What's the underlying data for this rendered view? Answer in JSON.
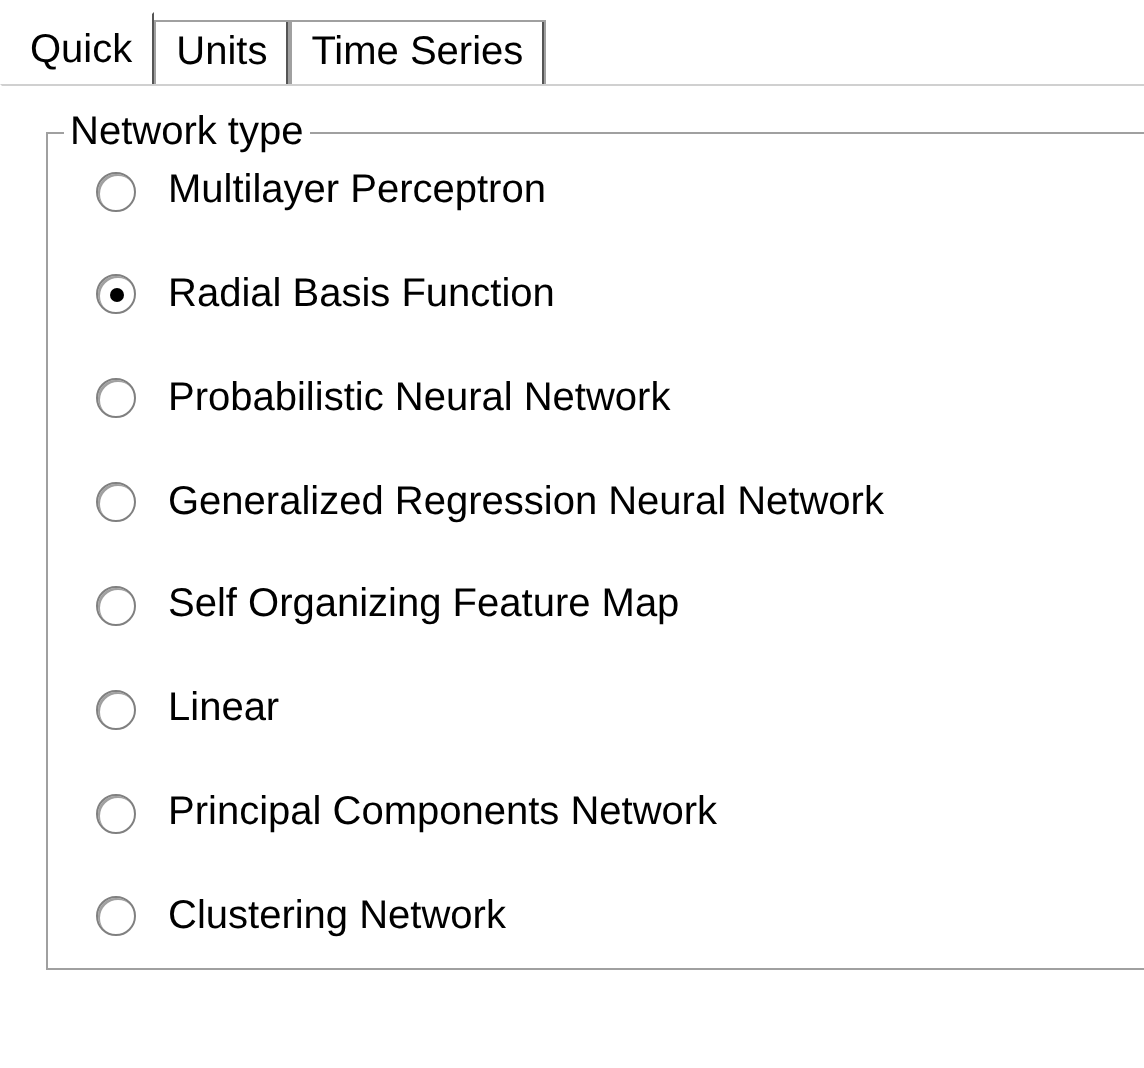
{
  "tabs": [
    {
      "label": "Quick",
      "selected": true
    },
    {
      "label": "Units",
      "selected": false
    },
    {
      "label": "Time Series",
      "selected": false
    }
  ],
  "group": {
    "title": "Network type",
    "options": [
      {
        "label": "Multilayer Perceptron",
        "selected": false
      },
      {
        "label": "Radial Basis Function",
        "selected": true
      },
      {
        "label": "Probabilistic Neural Network",
        "selected": false
      },
      {
        "label": "Generalized Regression Neural Network",
        "selected": false
      },
      {
        "label": "Self Organizing Feature Map",
        "selected": false
      },
      {
        "label": "Linear",
        "selected": false
      },
      {
        "label": "Principal Components Network",
        "selected": false
      },
      {
        "label": "Clustering Network",
        "selected": false
      }
    ]
  }
}
